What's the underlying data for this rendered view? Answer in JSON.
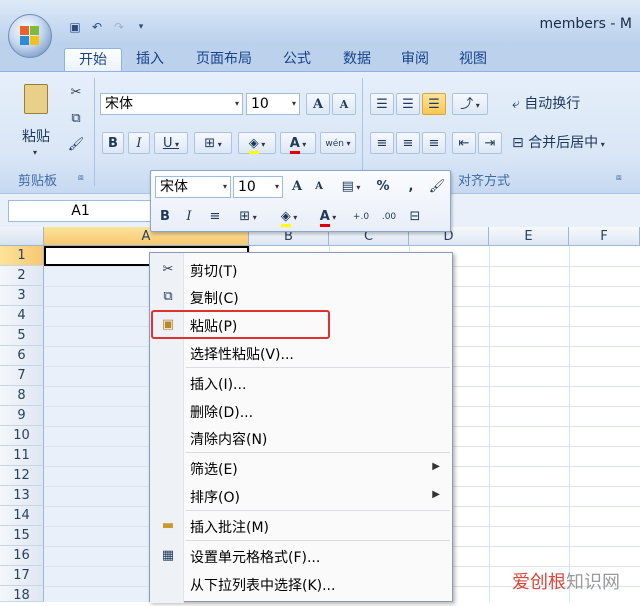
{
  "window": {
    "title": "members - M"
  },
  "tabs": [
    "开始",
    "插入",
    "页面布局",
    "公式",
    "数据",
    "审阅",
    "视图"
  ],
  "ribbon": {
    "paste_label": "粘贴",
    "clipboard_group": "剪贴板",
    "font_name": "宋体",
    "font_size": "10",
    "grow_font": "A",
    "shrink_font": "A",
    "bold": "B",
    "italic": "I",
    "underline": "U",
    "font_color": "A",
    "phonetic": "wén",
    "wrap_text": "自动换行",
    "merge_center": "合并后居中",
    "alignment_group": "对齐方式"
  },
  "formula_bar": {
    "name_box": "A1"
  },
  "grid": {
    "columns": [
      "A",
      "B",
      "C",
      "D",
      "E",
      "F"
    ],
    "rows": [
      "1",
      "2",
      "3",
      "4",
      "5",
      "6",
      "7",
      "8",
      "9",
      "10",
      "11",
      "12",
      "13",
      "14",
      "15",
      "16",
      "17",
      "18"
    ]
  },
  "mini_toolbar": {
    "font_name": "宋体",
    "font_size": "10",
    "grow": "A",
    "shrink": "A",
    "percent": "%",
    "comma": ",",
    "bold": "B",
    "italic": "I",
    "font_color": "A",
    "inc_decimal": "+.0",
    "dec_decimal": ".00"
  },
  "context_menu": {
    "items": [
      "剪切(T)",
      "复制(C)",
      "粘贴(P)",
      "选择性粘贴(V)...",
      "插入(I)...",
      "删除(D)...",
      "清除内容(N)",
      "筛选(E)",
      "排序(O)",
      "插入批注(M)",
      "设置单元格格式(F)...",
      "从下拉列表中选择(K)..."
    ]
  },
  "watermark": {
    "part1": "爱创根",
    "part2": "知识网"
  },
  "colors": {
    "highlight_border": "#e0302f",
    "selection": "#fde39b"
  }
}
